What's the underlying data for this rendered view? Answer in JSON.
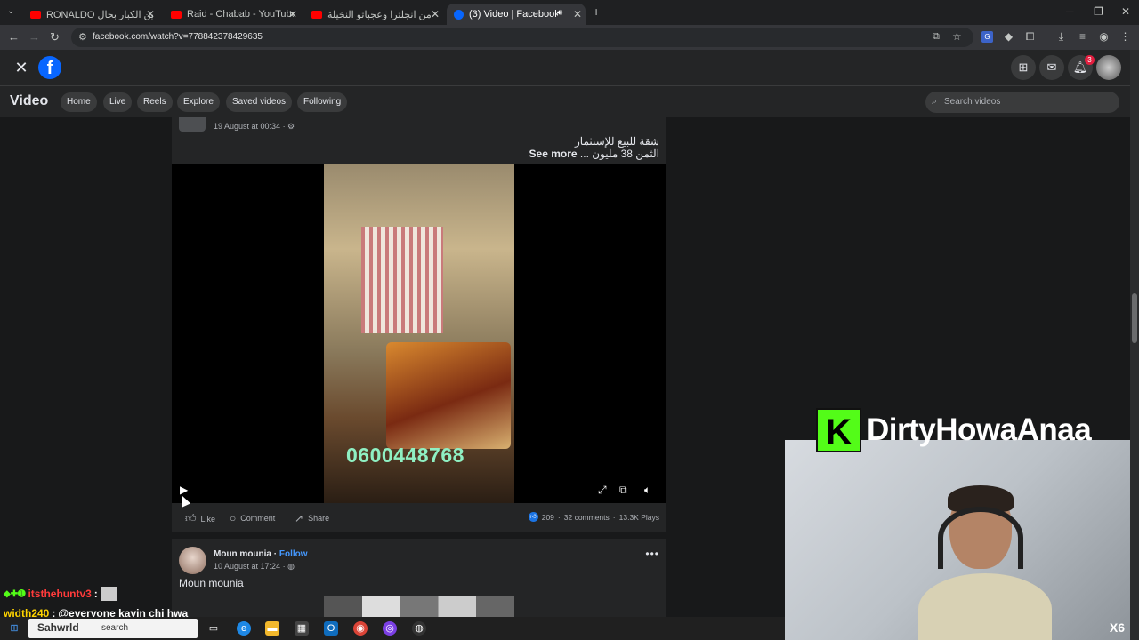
{
  "browser": {
    "tabs": [
      {
        "title": "RONALDO الرياضيين الكبار بحال",
        "favicon": "youtube-icon"
      },
      {
        "title": "Raid - Chabab - YouTube",
        "favicon": "youtube-icon"
      },
      {
        "title": "خويا جا من انجلترا وعجباتو النخيلة",
        "favicon": "youtube-icon"
      },
      {
        "title": "(3) Video | Facebook",
        "favicon": "facebook-icon"
      }
    ],
    "new_tab": "+",
    "url": "facebook.com/watch?v=778842378429635"
  },
  "fb_header": {
    "logo": "f",
    "notifications_count": "3"
  },
  "video_nav": {
    "title": "Video",
    "tabs": [
      "Home",
      "Live",
      "Reels",
      "Explore",
      "Saved videos",
      "Following"
    ],
    "search_placeholder": "Search videos"
  },
  "post1": {
    "timestamp": "19 August at 00:34 · ⚙",
    "text_line1": "شقة للبيع للإستثمار",
    "text_line2": "الثمن 38 مليون ...",
    "see_more": "See more",
    "video_phone": "0600448768",
    "actions": {
      "like": "Like",
      "comment": "Comment",
      "share": "Share"
    },
    "reactions_count": "209",
    "comments_count": "32 comments",
    "plays_count": "13.3K Plays"
  },
  "post2": {
    "author": "Moun mounia",
    "follow_separator": " · ",
    "follow": "Follow",
    "timestamp": "10 August at 17:24 · ",
    "text": "Moun mounia"
  },
  "stream": {
    "brand_logo": "K",
    "brand_name": "DirtyHowaAnaa",
    "multiplier": "X6",
    "chat": [
      {
        "user": "itsthehuntv3",
        "sep": " :",
        "message": ""
      },
      {
        "user": "width240",
        "sep": " :",
        "message": "@everyone kayin chi hwa"
      }
    ]
  },
  "taskbar": {
    "search_text": "search",
    "overlay_user": "Sahwrld"
  },
  "colors": {
    "fb_blue": "#0866ff",
    "kick_green": "#53fc18",
    "phone_text": "#8ff0c3",
    "follow_link": "#4599ff"
  }
}
